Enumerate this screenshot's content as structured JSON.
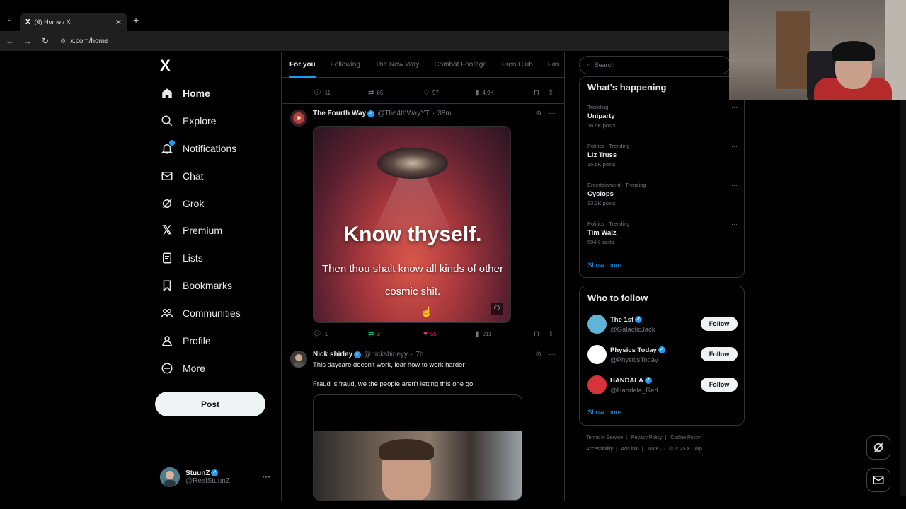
{
  "browser": {
    "tab_title": "(6) Home / X",
    "tab_favicon": "X",
    "url": "x.com/home"
  },
  "nav": {
    "logo": "X",
    "items": [
      {
        "label": "Home",
        "icon": "home-icon",
        "active": true
      },
      {
        "label": "Explore",
        "icon": "search-icon"
      },
      {
        "label": "Notifications",
        "icon": "bell-icon",
        "badge": true
      },
      {
        "label": "Chat",
        "icon": "mail-icon"
      },
      {
        "label": "Grok",
        "icon": "grok-icon"
      },
      {
        "label": "Premium",
        "icon": "x-icon"
      },
      {
        "label": "Lists",
        "icon": "list-icon"
      },
      {
        "label": "Bookmarks",
        "icon": "bookmark-icon"
      },
      {
        "label": "Communities",
        "icon": "people-icon"
      },
      {
        "label": "Profile",
        "icon": "person-icon"
      },
      {
        "label": "More",
        "icon": "more-circle-icon"
      }
    ],
    "post_label": "Post",
    "account": {
      "name": "StuunZ",
      "handle": "@RealStuunZ",
      "more": "···"
    }
  },
  "feed": {
    "tabs": [
      "For you",
      "Following",
      "The New Way",
      "Combat Footage",
      "Fren Club",
      "Fas"
    ],
    "prev_tweet_actions": {
      "replies": "11",
      "reposts": "65",
      "likes": "97",
      "views": "4.9K"
    },
    "tweet1": {
      "name": "The Fourth Way",
      "handle": "@The4thWayYT",
      "time": "38m",
      "media_title": "Know thyself.",
      "media_subtitle": "Then thou shalt know all kinds of other cosmic shit.",
      "replies": "1",
      "reposts": "3",
      "likes": "55",
      "views": "911"
    },
    "tweet2": {
      "name": "Nick shirley",
      "handle": "@nickshirleyy",
      "time": "7h",
      "line1": "This daycare doesn't work, lear how to work harder",
      "line2": "Fraud is fraud, we the people aren't letting this one go."
    }
  },
  "sidebar": {
    "search_placeholder": "Search",
    "happening_title": "What's happening",
    "trends": [
      {
        "category": "Trending",
        "name": "Uniparty",
        "count": "16.5K posts"
      },
      {
        "category": "Politics · Trending",
        "name": "Liz Truss",
        "count": "15.6K posts"
      },
      {
        "category": "Entertainment · Trending",
        "name": "Cyclops",
        "count": "33.3K posts"
      },
      {
        "category": "Politics · Trending",
        "name": "Tim Walz",
        "count": "504K posts"
      }
    ],
    "show_more": "Show more",
    "follow_title": "Who to follow",
    "follow": [
      {
        "name": "The 1st",
        "handle": "@GalacticJack",
        "color": "#5fb4d8"
      },
      {
        "name": "Physics Today",
        "handle": "@PhysicsToday",
        "color": "#ffffff"
      },
      {
        "name": "HANDALA",
        "handle": "@Handala_Red",
        "color": "#d8323a"
      }
    ],
    "follow_label": "Follow",
    "footer": [
      "Terms of Service",
      "|",
      "Privacy Policy",
      "|",
      "Cookie Policy",
      "|",
      "Accessibility",
      "|",
      "Ads info",
      "|",
      "More ···",
      "© 2025 X Corp."
    ]
  },
  "colors": {
    "accent": "#1d9bf0",
    "like": "#f91880",
    "repost": "#00ba7c"
  }
}
